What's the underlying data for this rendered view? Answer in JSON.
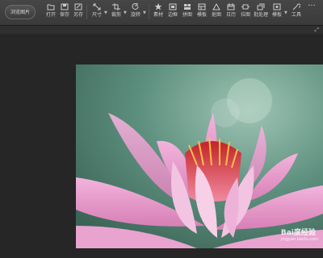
{
  "toolbar": {
    "browse_label": "浏览图片",
    "tools": [
      {
        "label": "打开",
        "icon": "open-icon"
      },
      {
        "label": "保存",
        "icon": "save-icon"
      },
      {
        "label": "另存",
        "icon": "save-as-icon"
      },
      {
        "label": "尺寸",
        "icon": "resize-icon"
      },
      {
        "label": "裁剪",
        "icon": "crop-icon"
      },
      {
        "label": "旋转",
        "icon": "rotate-icon"
      },
      {
        "label": "素材",
        "icon": "material-icon"
      },
      {
        "label": "边框",
        "icon": "border-icon"
      },
      {
        "label": "拼图",
        "icon": "collage-icon"
      },
      {
        "label": "模板",
        "icon": "template-icon"
      },
      {
        "label": "抠图",
        "icon": "cutout-icon"
      },
      {
        "label": "日历",
        "icon": "calendar-icon"
      },
      {
        "label": "拉图",
        "icon": "stretch-icon"
      },
      {
        "label": "批处理",
        "icon": "batch-icon"
      },
      {
        "label": "模板",
        "icon": "template2-icon"
      },
      {
        "label": "工具",
        "icon": "tools-icon"
      }
    ]
  },
  "photo": {
    "watermark_main": "Bai度经验",
    "watermark_sub": "jingyan.baidu.com"
  },
  "colors": {
    "toolbar_bg": "#3f3f3f",
    "canvas_bg": "#262626",
    "petal_pink": "#e58bc3",
    "center_red": "#d83a3a",
    "photo_bg": "#5f8f7f"
  }
}
